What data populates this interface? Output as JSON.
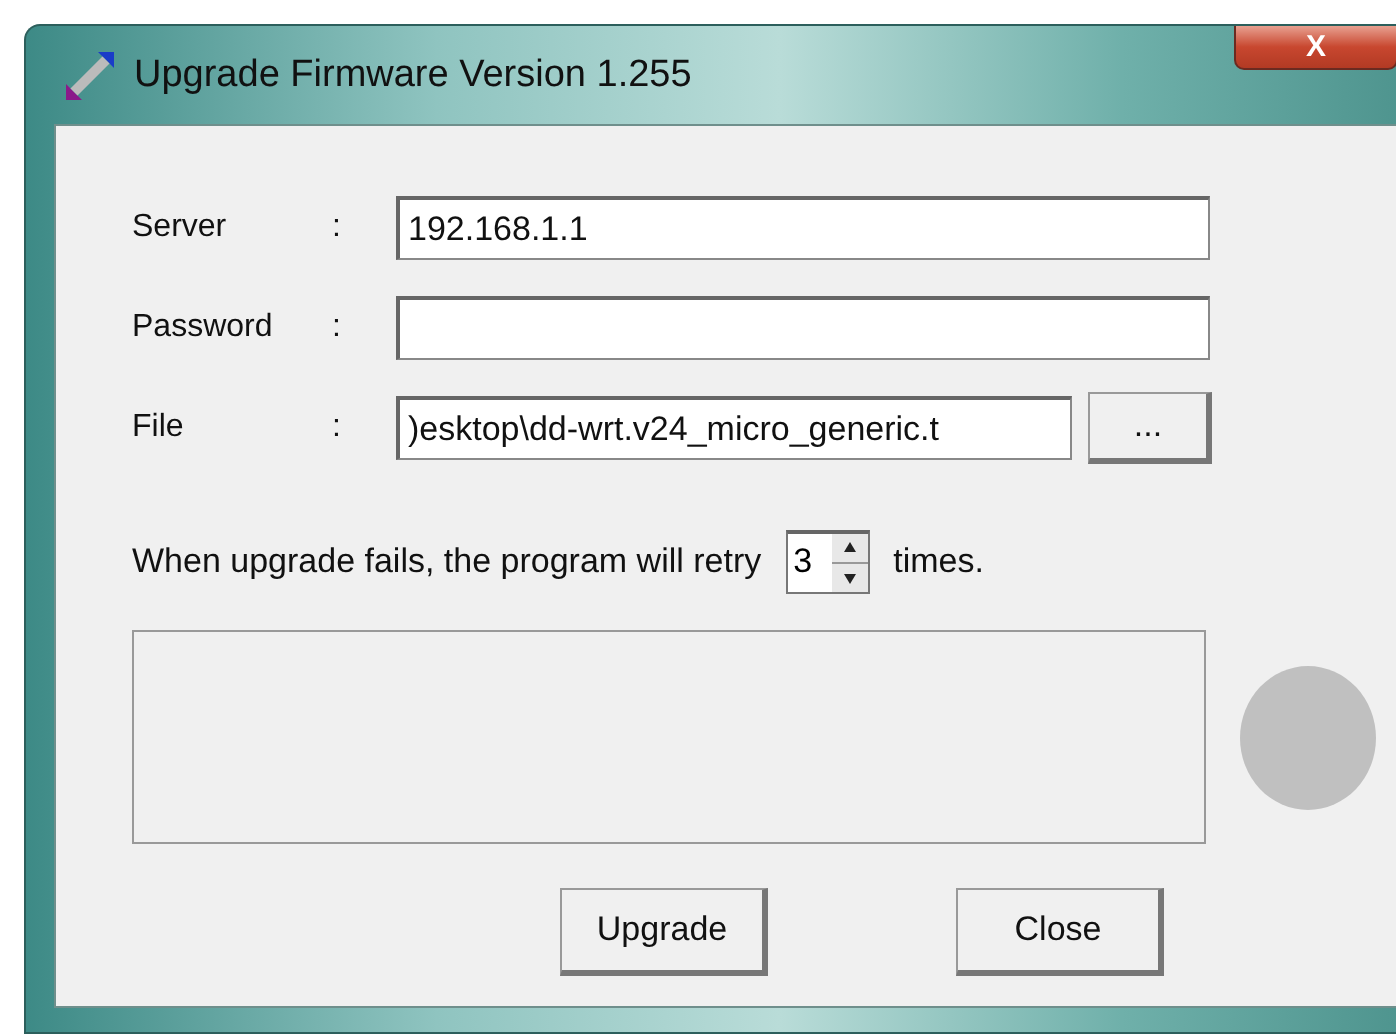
{
  "window": {
    "title": "Upgrade Firmware Version 1.255",
    "close_label": "X"
  },
  "fields": [
    {
      "label": "Server",
      "colon": ":",
      "value": "192.168.1.1"
    },
    {
      "label": "Password",
      "colon": ":"
    },
    {
      "label": "File",
      "colon": ":",
      "value": ")esktop\\dd-wrt.v24_micro_generic.t",
      "browse": "..."
    }
  ],
  "retry": {
    "before": "When upgrade fails, the program will retry",
    "value": "3",
    "after": "times."
  },
  "buttons": [
    {
      "label": "Upgrade"
    },
    {
      "label": "Close"
    }
  ]
}
